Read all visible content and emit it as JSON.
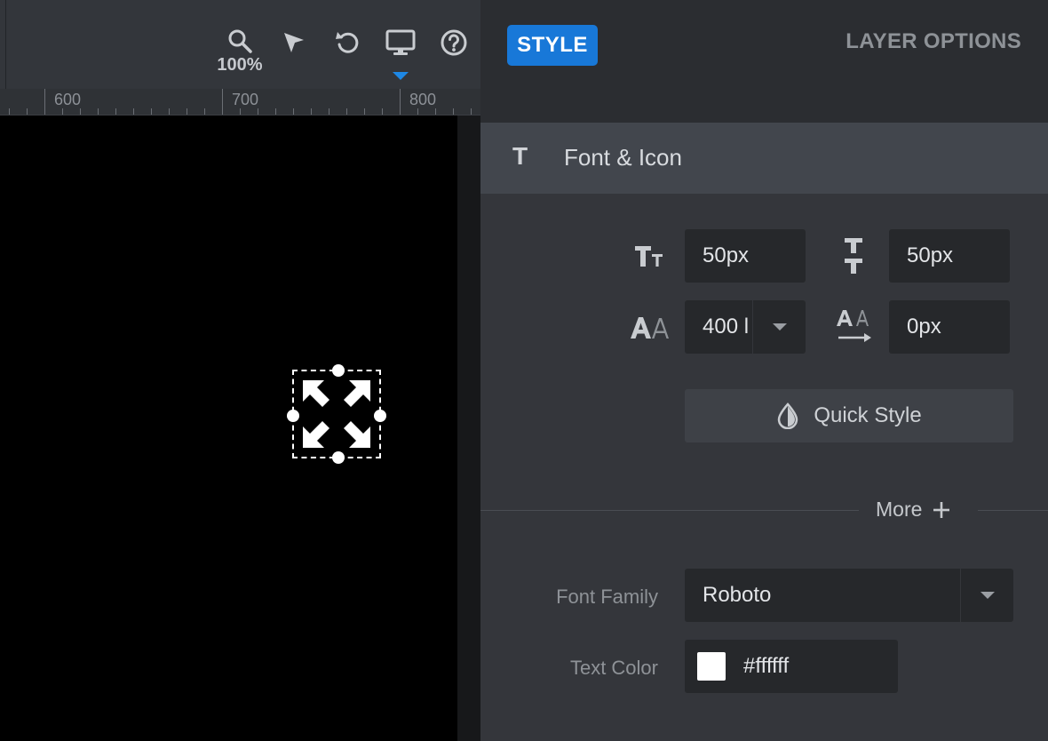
{
  "toolbar": {
    "zoom_level": "100%",
    "tools": [
      {
        "name": "zoom-tool",
        "icon": "magnifier-icon"
      },
      {
        "name": "select-tool",
        "icon": "pointer-arrow-icon"
      },
      {
        "name": "undo-tool",
        "icon": "rotate-left-icon"
      },
      {
        "name": "device-view",
        "icon": "desktop-monitor-icon"
      },
      {
        "name": "help",
        "icon": "question-circle-icon"
      }
    ],
    "active_device_indicator_color": "#1e88e5"
  },
  "ruler": {
    "labels": [
      "600",
      "700",
      "800"
    ]
  },
  "canvas": {
    "background": "#000000",
    "selected_layer_icon": "expand-arrows-icon",
    "selected_layer_color": "#ffffff"
  },
  "panel": {
    "tabs": {
      "style_label": "STYLE",
      "layer_options_label": "LAYER OPTIONS"
    },
    "accent_color": "#1878d8",
    "section": {
      "icon": "text-type-icon",
      "icon_glyph": "T",
      "title": "Font & Icon"
    },
    "font_size": {
      "icon": "font-size-icon",
      "value": "50px"
    },
    "line_height": {
      "icon": "line-height-icon",
      "value": "50px"
    },
    "font_weight": {
      "icon": "font-weight-icon",
      "value": "400 l"
    },
    "letter_spacing": {
      "icon": "letter-spacing-icon",
      "value": "0px"
    },
    "quick_style": {
      "icon": "droplet-half-icon",
      "label": "Quick Style"
    },
    "more": {
      "label": "More",
      "icon": "plus-icon"
    },
    "font_family": {
      "label": "Font Family",
      "value": "Roboto"
    },
    "text_color": {
      "label": "Text Color",
      "value": "#ffffff",
      "swatch": "#ffffff"
    }
  }
}
